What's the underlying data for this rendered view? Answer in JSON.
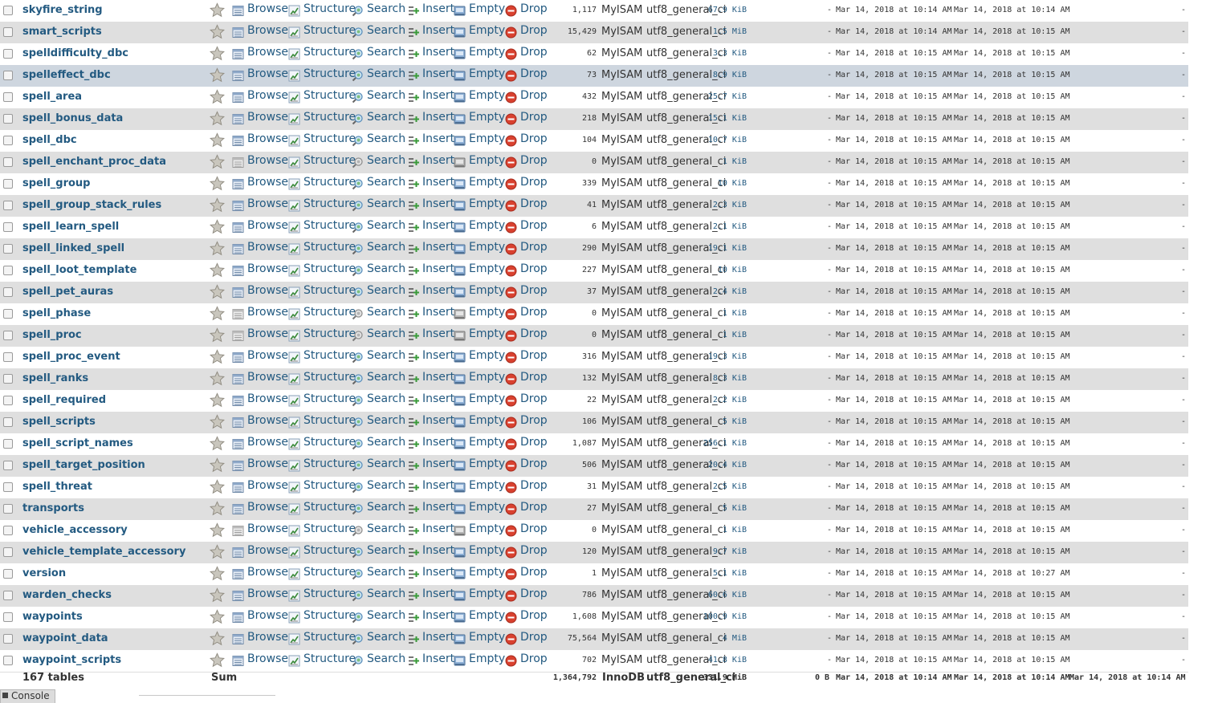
{
  "actions": {
    "browse": "Browse",
    "structure": "Structure",
    "search": "Search",
    "insert": "Insert",
    "empty": "Empty",
    "drop": "Drop"
  },
  "colors": {
    "link": "#235a81",
    "row_alt": "#dfdfdf",
    "row_selected": "#ced6df",
    "drop_icon": "#d9412f"
  },
  "tables": [
    {
      "name": "skyfire_string",
      "rows": "1,117",
      "engine": "MyISAM",
      "collation": "utf8_general_ci",
      "size": "67.9 KiB",
      "overhead": "-",
      "created": "Mar 14, 2018 at 10:14 AM",
      "updated": "Mar 14, 2018 at 10:14 AM",
      "checked": "-"
    },
    {
      "name": "smart_scripts",
      "rows": "15,429",
      "engine": "MyISAM",
      "collation": "utf8_general_ci",
      "size": "1.5 MiB",
      "overhead": "-",
      "created": "Mar 14, 2018 at 10:14 AM",
      "updated": "Mar 14, 2018 at 10:15 AM",
      "checked": "-"
    },
    {
      "name": "spelldifficulty_dbc",
      "rows": "62",
      "engine": "MyISAM",
      "collation": "utf8_general_ci",
      "size": "3.3 KiB",
      "overhead": "-",
      "created": "Mar 14, 2018 at 10:15 AM",
      "updated": "Mar 14, 2018 at 10:15 AM",
      "checked": "-"
    },
    {
      "name": "spelleffect_dbc",
      "rows": "73",
      "engine": "MyISAM",
      "collation": "utf8_general_ci",
      "size": "8.9 KiB",
      "overhead": "-",
      "created": "Mar 14, 2018 at 10:15 AM",
      "updated": "Mar 14, 2018 at 10:15 AM",
      "checked": "-",
      "selected": true
    },
    {
      "name": "spell_area",
      "rows": "432",
      "engine": "MyISAM",
      "collation": "utf8_general_ci",
      "size": "25.7 KiB",
      "overhead": "-",
      "created": "Mar 14, 2018 at 10:15 AM",
      "updated": "Mar 14, 2018 at 10:15 AM",
      "checked": "-"
    },
    {
      "name": "spell_bonus_data",
      "rows": "218",
      "engine": "MyISAM",
      "collation": "utf8_general_ci",
      "size": "15.1 KiB",
      "overhead": "-",
      "created": "Mar 14, 2018 at 10:15 AM",
      "updated": "Mar 14, 2018 at 10:15 AM",
      "checked": "-"
    },
    {
      "name": "spell_dbc",
      "rows": "104",
      "engine": "MyISAM",
      "collation": "utf8_general_ci",
      "size": "10.7 KiB",
      "overhead": "-",
      "created": "Mar 14, 2018 at 10:15 AM",
      "updated": "Mar 14, 2018 at 10:15 AM",
      "checked": "-"
    },
    {
      "name": "spell_enchant_proc_data",
      "rows": "0",
      "engine": "MyISAM",
      "collation": "utf8_general_ci",
      "size": "1 KiB",
      "overhead": "-",
      "created": "Mar 14, 2018 at 10:15 AM",
      "updated": "Mar 14, 2018 at 10:15 AM",
      "checked": "-",
      "empty": true
    },
    {
      "name": "spell_group",
      "rows": "339",
      "engine": "MyISAM",
      "collation": "utf8_general_ci",
      "size": "10 KiB",
      "overhead": "-",
      "created": "Mar 14, 2018 at 10:15 AM",
      "updated": "Mar 14, 2018 at 10:15 AM",
      "checked": "-"
    },
    {
      "name": "spell_group_stack_rules",
      "rows": "41",
      "engine": "MyISAM",
      "collation": "utf8_general_ci",
      "size": "2.3 KiB",
      "overhead": "-",
      "created": "Mar 14, 2018 at 10:15 AM",
      "updated": "Mar 14, 2018 at 10:15 AM",
      "checked": "-"
    },
    {
      "name": "spell_learn_spell",
      "rows": "6",
      "engine": "MyISAM",
      "collation": "utf8_general_ci",
      "size": "2.1 KiB",
      "overhead": "-",
      "created": "Mar 14, 2018 at 10:15 AM",
      "updated": "Mar 14, 2018 at 10:15 AM",
      "checked": "-"
    },
    {
      "name": "spell_linked_spell",
      "rows": "290",
      "engine": "MyISAM",
      "collation": "utf8_general_ci",
      "size": "19.1 KiB",
      "overhead": "-",
      "created": "Mar 14, 2018 at 10:15 AM",
      "updated": "Mar 14, 2018 at 10:15 AM",
      "checked": "-"
    },
    {
      "name": "spell_loot_template",
      "rows": "227",
      "engine": "MyISAM",
      "collation": "utf8_general_ci",
      "size": "10 KiB",
      "overhead": "-",
      "created": "Mar 14, 2018 at 10:15 AM",
      "updated": "Mar 14, 2018 at 10:15 AM",
      "checked": "-"
    },
    {
      "name": "spell_pet_auras",
      "rows": "37",
      "engine": "MyISAM",
      "collation": "utf8_general_ci",
      "size": "2.4 KiB",
      "overhead": "-",
      "created": "Mar 14, 2018 at 10:15 AM",
      "updated": "Mar 14, 2018 at 10:15 AM",
      "checked": "-"
    },
    {
      "name": "spell_phase",
      "rows": "0",
      "engine": "MyISAM",
      "collation": "utf8_general_ci",
      "size": "1 KiB",
      "overhead": "-",
      "created": "Mar 14, 2018 at 10:15 AM",
      "updated": "Mar 14, 2018 at 10:15 AM",
      "checked": "-",
      "empty": true
    },
    {
      "name": "spell_proc",
      "rows": "0",
      "engine": "MyISAM",
      "collation": "utf8_general_ci",
      "size": "1 KiB",
      "overhead": "-",
      "created": "Mar 14, 2018 at 10:15 AM",
      "updated": "Mar 14, 2018 at 10:15 AM",
      "checked": "-",
      "empty": true
    },
    {
      "name": "spell_proc_event",
      "rows": "316",
      "engine": "MyISAM",
      "collation": "utf8_general_ci",
      "size": "19.3 KiB",
      "overhead": "-",
      "created": "Mar 14, 2018 at 10:15 AM",
      "updated": "Mar 14, 2018 at 10:15 AM",
      "checked": "-"
    },
    {
      "name": "spell_ranks",
      "rows": "132",
      "engine": "MyISAM",
      "collation": "utf8_general_ci",
      "size": "8.3 KiB",
      "overhead": "-",
      "created": "Mar 14, 2018 at 10:15 AM",
      "updated": "Mar 14, 2018 at 10:15 AM",
      "checked": "-"
    },
    {
      "name": "spell_required",
      "rows": "22",
      "engine": "MyISAM",
      "collation": "utf8_general_ci",
      "size": "2.2 KiB",
      "overhead": "-",
      "created": "Mar 14, 2018 at 10:15 AM",
      "updated": "Mar 14, 2018 at 10:15 AM",
      "checked": "-"
    },
    {
      "name": "spell_scripts",
      "rows": "106",
      "engine": "MyISAM",
      "collation": "utf8_general_ci",
      "size": "5 KiB",
      "overhead": "-",
      "created": "Mar 14, 2018 at 10:15 AM",
      "updated": "Mar 14, 2018 at 10:15 AM",
      "checked": "-"
    },
    {
      "name": "spell_script_names",
      "rows": "1,087",
      "engine": "MyISAM",
      "collation": "utf8_general_ci",
      "size": "256.1 KiB",
      "overhead": "-",
      "created": "Mar 14, 2018 at 10:15 AM",
      "updated": "Mar 14, 2018 at 10:15 AM",
      "checked": "-"
    },
    {
      "name": "spell_target_position",
      "rows": "506",
      "engine": "MyISAM",
      "collation": "utf8_general_ci",
      "size": "20.4 KiB",
      "overhead": "-",
      "created": "Mar 14, 2018 at 10:15 AM",
      "updated": "Mar 14, 2018 at 10:15 AM",
      "checked": "-"
    },
    {
      "name": "spell_threat",
      "rows": "31",
      "engine": "MyISAM",
      "collation": "utf8_general_ci",
      "size": "2.5 KiB",
      "overhead": "-",
      "created": "Mar 14, 2018 at 10:15 AM",
      "updated": "Mar 14, 2018 at 10:15 AM",
      "checked": "-"
    },
    {
      "name": "transports",
      "rows": "27",
      "engine": "MyISAM",
      "collation": "utf8_general_ci",
      "size": "5 KiB",
      "overhead": "-",
      "created": "Mar 14, 2018 at 10:15 AM",
      "updated": "Mar 14, 2018 at 10:15 AM",
      "checked": "-"
    },
    {
      "name": "vehicle_accessory",
      "rows": "0",
      "engine": "MyISAM",
      "collation": "utf8_general_ci",
      "size": "1 KiB",
      "overhead": "-",
      "created": "Mar 14, 2018 at 10:15 AM",
      "updated": "Mar 14, 2018 at 10:15 AM",
      "checked": "-",
      "empty": true
    },
    {
      "name": "vehicle_template_accessory",
      "rows": "120",
      "engine": "MyISAM",
      "collation": "utf8_general_ci",
      "size": "9.7 KiB",
      "overhead": "-",
      "created": "Mar 14, 2018 at 10:15 AM",
      "updated": "Mar 14, 2018 at 10:15 AM",
      "checked": "-"
    },
    {
      "name": "version",
      "rows": "1",
      "engine": "MyISAM",
      "collation": "utf8_general_ci",
      "size": "5.1 KiB",
      "overhead": "-",
      "created": "Mar 14, 2018 at 10:15 AM",
      "updated": "Mar 14, 2018 at 10:27 AM",
      "checked": "-"
    },
    {
      "name": "warden_checks",
      "rows": "786",
      "engine": "MyISAM",
      "collation": "utf8_general_ci",
      "size": "60.6 KiB",
      "overhead": "-",
      "created": "Mar 14, 2018 at 10:15 AM",
      "updated": "Mar 14, 2018 at 10:15 AM",
      "checked": "-"
    },
    {
      "name": "waypoints",
      "rows": "1,608",
      "engine": "MyISAM",
      "collation": "utf8_general_ci",
      "size": "100.9 KiB",
      "overhead": "-",
      "created": "Mar 14, 2018 at 10:15 AM",
      "updated": "Mar 14, 2018 at 10:15 AM",
      "checked": "-"
    },
    {
      "name": "waypoint_data",
      "rows": "75,564",
      "engine": "MyISAM",
      "collation": "utf8_general_ci",
      "size": "4 MiB",
      "overhead": "-",
      "created": "Mar 14, 2018 at 10:15 AM",
      "updated": "Mar 14, 2018 at 10:15 AM",
      "checked": "-"
    },
    {
      "name": "waypoint_scripts",
      "rows": "702",
      "engine": "MyISAM",
      "collation": "utf8_general_ci",
      "size": "41.8 KiB",
      "overhead": "-",
      "created": "Mar 14, 2018 at 10:15 AM",
      "updated": "Mar 14, 2018 at 10:15 AM",
      "checked": "-"
    }
  ],
  "summary": {
    "count": "167 tables",
    "label": "Sum",
    "rows": "1,364,792",
    "engine": "InnoDB",
    "collation": "utf8_general_ci",
    "size": "331.9 MiB",
    "overhead": "0 B",
    "created": "Mar 14, 2018 at 10:14 AM",
    "updated": "Mar 14, 2018 at 10:14 AM",
    "checked": "Mar 14, 2018 at 10:14 AM"
  },
  "console": {
    "label": "Console"
  }
}
